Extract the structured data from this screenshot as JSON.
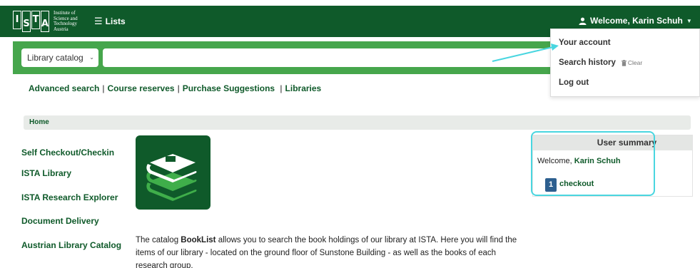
{
  "header": {
    "logo_letters": [
      "I",
      "S",
      "T",
      "A"
    ],
    "logo_text_lines": [
      "Institute of",
      "Science and",
      "Technology",
      "Austria"
    ],
    "lists_label": "Lists",
    "welcome_label": "Welcome, Karin Schuh"
  },
  "search": {
    "catalog_selected": "Library catalog",
    "query_value": ""
  },
  "nav_links": [
    "Advanced search",
    "Course reserves",
    "Purchase Suggestions",
    "Libraries"
  ],
  "breadcrumb": {
    "home": "Home"
  },
  "sidebar": {
    "items": [
      "Self Checkout/Checkin",
      "ISTA Library",
      "ISTA Research Explorer",
      "Document Delivery",
      "Austrian Library Catalog"
    ]
  },
  "main": {
    "desc_before": "The catalog ",
    "desc_bold": "BookList",
    "desc_after": " allows you to search the book holdings of our library at ISTA. Here you will find the items of our library - located on the ground floor of Sunstone Building - as well as the books of each research group."
  },
  "user_summary": {
    "title": "User summary",
    "welcome_prefix": "Welcome, ",
    "user_name": "Karin Schuh",
    "checkout_count": "1",
    "checkout_label": "checkout"
  },
  "account_menu": {
    "your_account": "Your account",
    "search_history": "Search history",
    "clear": "Clear",
    "log_out": "Log out"
  },
  "colors": {
    "brand_dark_green": "#0f5a2a",
    "search_green": "#46a64c",
    "highlight_cyan": "#49d6e0",
    "badge_blue": "#2d5f8f"
  }
}
